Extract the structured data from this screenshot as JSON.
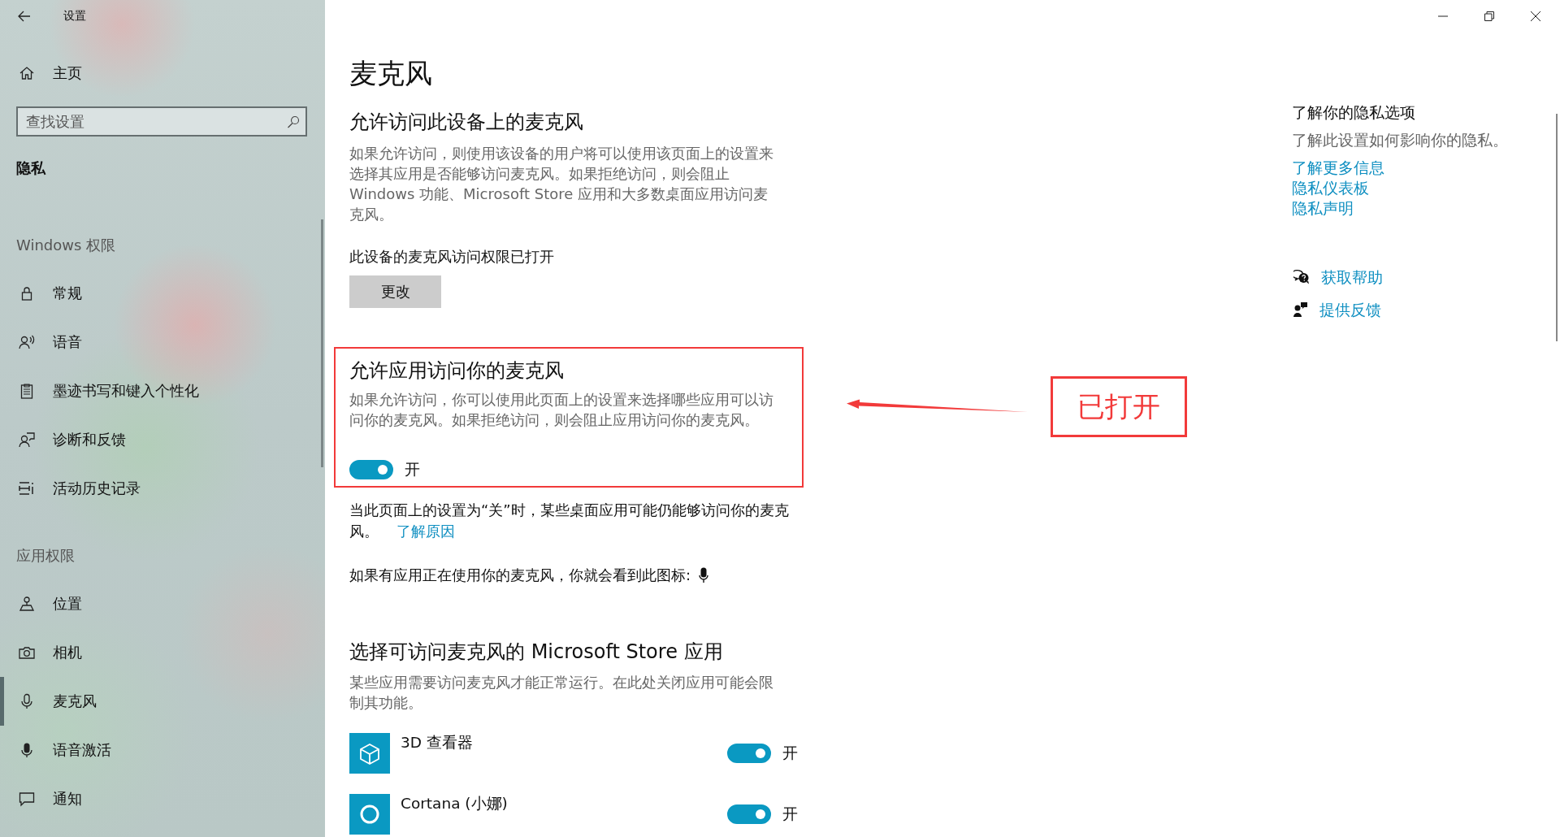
{
  "window": {
    "title": "设置"
  },
  "sidebar": {
    "home": "主页",
    "search": {
      "placeholder": "查找设置"
    },
    "section_title": "隐私",
    "groups": [
      {
        "heading": "Windows 权限",
        "items": [
          {
            "label": "常规",
            "selected": false
          },
          {
            "label": "语音",
            "selected": false
          },
          {
            "label": "墨迹书写和键入个性化",
            "selected": false
          },
          {
            "label": "诊断和反馈",
            "selected": false
          },
          {
            "label": "活动历史记录",
            "selected": false
          }
        ]
      },
      {
        "heading": "应用权限",
        "items": [
          {
            "label": "位置",
            "selected": false
          },
          {
            "label": "相机",
            "selected": false
          },
          {
            "label": "麦克风",
            "selected": true
          },
          {
            "label": "语音激活",
            "selected": false
          },
          {
            "label": "通知",
            "selected": false
          }
        ]
      }
    ]
  },
  "page": {
    "title": "麦克风",
    "device_access": {
      "heading": "允许访问此设备上的麦克风",
      "description": "如果允许访问，则使用该设备的用户将可以使用该页面上的设置来选择其应用是否能够访问麦克风。如果拒绝访问，则会阻止 Windows 功能、Microsoft Store 应用和大多数桌面应用访问麦克风。",
      "status": "此设备的麦克风访问权限已打开",
      "button": "更改"
    },
    "app_access": {
      "heading": "允许应用访问你的麦克风",
      "description": "如果允许访问，你可以使用此页面上的设置来选择哪些应用可以访问你的麦克风。如果拒绝访问，则会阻止应用访问你的麦克风。",
      "toggle": {
        "on": true,
        "label": "开"
      }
    },
    "note": {
      "text": "当此页面上的设置为“关”时，某些桌面应用可能仍能够访问你的麦克风。",
      "link": "了解原因"
    },
    "indicator_note": "如果有应用正在使用你的麦克风，你就会看到此图标:",
    "store_apps": {
      "heading": "选择可访问麦克风的 Microsoft Store 应用",
      "description": "某些应用需要访问麦克风才能正常运行。在此处关闭应用可能会限制其功能。",
      "apps": [
        {
          "name": "3D 查看器",
          "on": true,
          "label": "开"
        },
        {
          "name": "Cortana (小娜)",
          "on": true,
          "label": "开"
        }
      ]
    }
  },
  "aside": {
    "heading": "了解你的隐私选项",
    "description": "了解此设置如何影响你的隐私。",
    "links": [
      "了解更多信息",
      "隐私仪表板",
      "隐私声明"
    ],
    "support": [
      "获取帮助",
      "提供反馈"
    ]
  },
  "annotation": {
    "label": "已打开"
  }
}
